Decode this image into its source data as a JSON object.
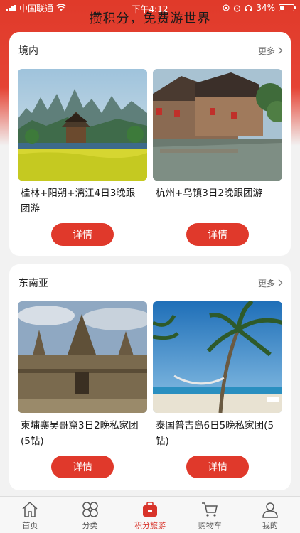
{
  "status_bar": {
    "carrier": "中国联通",
    "time": "下午4:12",
    "battery": "34%",
    "battery_level": 0.34
  },
  "header": {
    "title": "攒积分，免费游世界"
  },
  "sections": [
    {
      "title": "境内",
      "more_label": "更多",
      "products": [
        {
          "name": "桂林+阳朔+漓江4日3晚跟团游",
          "button": "详情"
        },
        {
          "name": "杭州+乌镇3日2晚跟团游",
          "button": "详情"
        }
      ]
    },
    {
      "title": "东南亚",
      "more_label": "更多",
      "products": [
        {
          "name": "柬埔寨吴哥窟3日2晚私家团(5钻)",
          "button": "详情"
        },
        {
          "name": "泰国普吉岛6日5晚私家团(5钻)",
          "button": "详情"
        }
      ]
    }
  ],
  "tabbar": {
    "items": [
      {
        "label": "首页",
        "icon": "home-icon"
      },
      {
        "label": "分类",
        "icon": "grid-icon"
      },
      {
        "label": "积分旅游",
        "icon": "suitcase-icon",
        "active": true
      },
      {
        "label": "购物车",
        "icon": "cart-icon"
      },
      {
        "label": "我的",
        "icon": "person-icon"
      }
    ]
  },
  "colors": {
    "accent": "#e0392b",
    "active_tab": "#d8332a"
  }
}
